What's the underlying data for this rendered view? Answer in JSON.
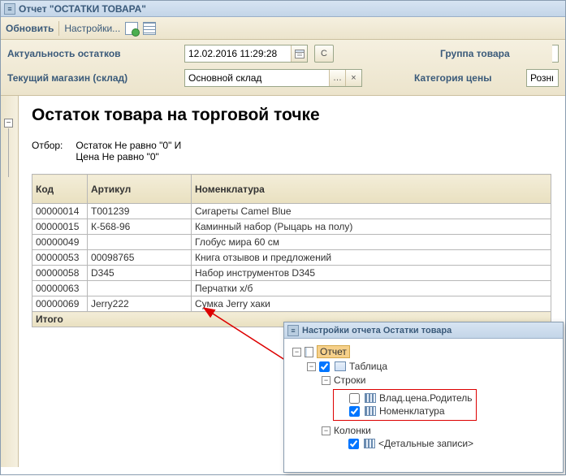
{
  "window": {
    "title": "Отчет  \"ОСТАТКИ ТОВАРА\""
  },
  "toolbar": {
    "update": "Обновить",
    "settings": "Настройки..."
  },
  "params": {
    "actuality_label": "Актуальность остатков",
    "actuality_value": "12.02.2016 11:29:28",
    "c_button": "С",
    "group_label": "Группа товара",
    "warehouse_label": "Текущий магазин (склад)",
    "warehouse_value": "Основной склад",
    "price_cat_label": "Категория цены",
    "price_cat_value": "Розни"
  },
  "report": {
    "title": "Остаток товара на торговой точке",
    "filter_label": "Отбор:",
    "filter_line1": "Остаток Не равно \"0\" И",
    "filter_line2": "Цена Не равно \"0\"",
    "columns": {
      "code": "Код",
      "art": "Артикул",
      "nom": "Номенклатура"
    },
    "rows": [
      {
        "code": "00000014",
        "art": "Т001239",
        "nom": "Сигареты Camel Blue"
      },
      {
        "code": "00000015",
        "art": "К-568-96",
        "nom": "Каминный набор (Рыцарь на полу)"
      },
      {
        "code": "00000049",
        "art": "",
        "nom": "Глобус мира 60 см"
      },
      {
        "code": "00000053",
        "art": "00098765",
        "nom": "Книга отзывов и предложений"
      },
      {
        "code": "00000058",
        "art": "D345",
        "nom": "Набор инструментов D345"
      },
      {
        "code": "00000063",
        "art": "",
        "nom": "Перчатки х/б"
      },
      {
        "code": "00000069",
        "art": "Jerry222",
        "nom": "Сумка Jerry хаки"
      }
    ],
    "total_label": "Итого"
  },
  "popup": {
    "title": "Настройки отчета  Остатки товара",
    "node_report": "Отчет",
    "node_table": "Таблица",
    "node_rows": "Строки",
    "node_owner_price_parent": "Влад.цена.Родитель",
    "node_nomenclature": "Номенклатура",
    "node_columns": "Колонки",
    "node_detail": "<Детальные записи>"
  }
}
